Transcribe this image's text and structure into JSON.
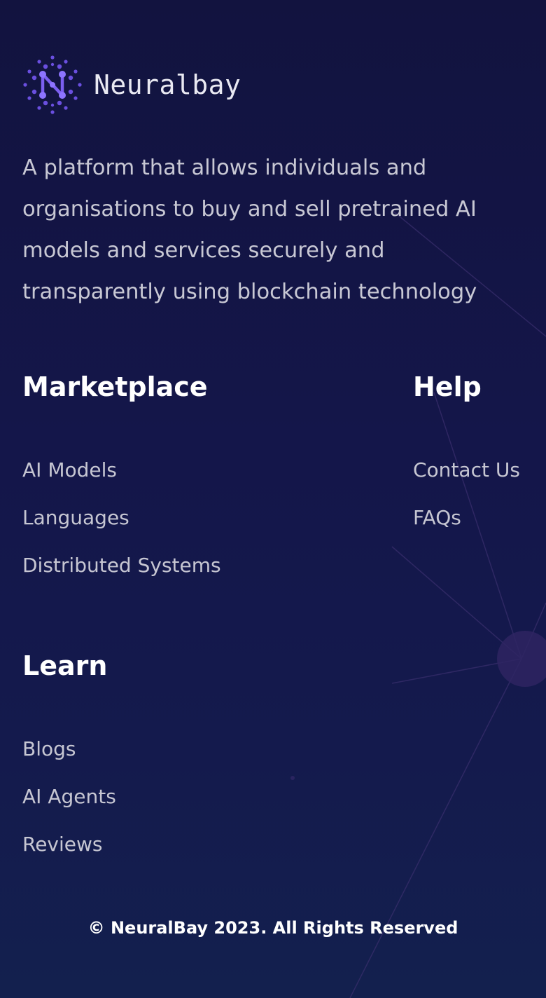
{
  "brand": {
    "name": "Neuralbay"
  },
  "tagline": "A platform that allows individuals and organisations to buy and sell pretrained AI models and services securely and transparently using blockchain technology",
  "sections": {
    "marketplace": {
      "title": "Marketplace",
      "links": [
        "AI Models",
        "Languages",
        "Distributed Systems"
      ]
    },
    "help": {
      "title": "Help",
      "links": [
        "Contact Us",
        "FAQs"
      ]
    },
    "learn": {
      "title": "Learn",
      "links": [
        "Blogs",
        "AI Agents",
        "Reviews"
      ]
    }
  },
  "footer": {
    "copyright": "© NeuralBay 2023. All Rights Reserved"
  },
  "colors": {
    "background": "#12133f",
    "accent": "#6a4fe0",
    "node": "#3a2a6a"
  }
}
